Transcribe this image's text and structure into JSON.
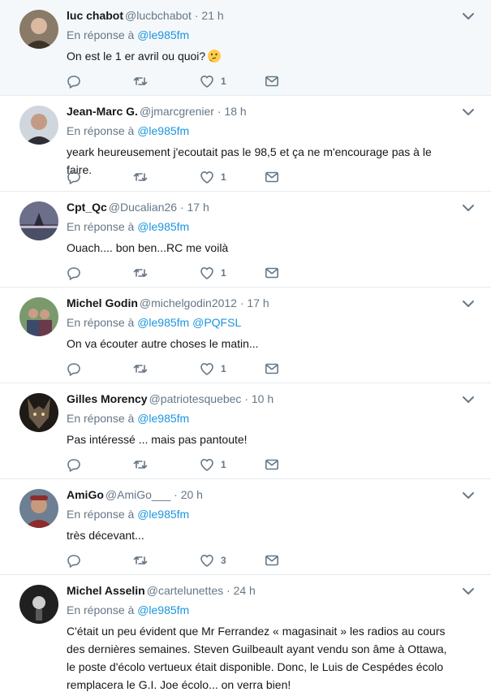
{
  "colors": {
    "accent": "#1b95e0",
    "muted": "#657786",
    "text": "#14171a",
    "highlight_bg": "#f5f8fa"
  },
  "reply_prefix": "En réponse à",
  "tweets": [
    {
      "name": "luc chabot",
      "handle": "@lucbchabot",
      "time": "21 h",
      "mentions": [
        "@le985fm"
      ],
      "text": "On est le 1 er avril ou quoi?",
      "emoji": "thinking-face",
      "likes": "1",
      "avatar": "avatar-1"
    },
    {
      "name": "Jean-Marc G.",
      "handle": "@jmarcgrenier",
      "time": "18 h",
      "mentions": [
        "@le985fm"
      ],
      "text": "yeark heureusement j'ecoutait pas le 98,5 et ça ne m'encourage pas à le faire.",
      "likes": "1",
      "avatar": "avatar-2"
    },
    {
      "name": "Cpt_Qc",
      "handle": "@Ducalian26",
      "time": "17 h",
      "mentions": [
        "@le985fm"
      ],
      "text": "Ouach.... bon ben...RC me voilà",
      "likes": "1",
      "avatar": "avatar-3"
    },
    {
      "name": "Michel Godin",
      "handle": "@michelgodin2012",
      "time": "17 h",
      "mentions": [
        "@le985fm",
        "@PQFSL"
      ],
      "text": "On va écouter autre choses le matin...",
      "likes": "1",
      "avatar": "avatar-4"
    },
    {
      "name": "Gilles Morency",
      "handle": "@patriotesquebec",
      "time": "10 h",
      "mentions": [
        "@le985fm"
      ],
      "text": "Pas intéressé ... mais pas pantoute!",
      "likes": "1",
      "avatar": "avatar-5"
    },
    {
      "name": "AmiGo",
      "handle": "@AmiGo___",
      "time": "20 h",
      "mentions": [
        "@le985fm"
      ],
      "text": "très décevant...",
      "likes": "3",
      "avatar": "avatar-6"
    },
    {
      "name": "Michel Asselin",
      "handle": "@cartelunettes",
      "time": "24 h",
      "mentions": [
        "@le985fm"
      ],
      "text": "C'était un peu évident que Mr Ferrandez « magasinait » les radios au cours des dernières semaines. Steven Guilbeault ayant vendu son âme à Ottawa, le poste d'écolo vertueux était disponible. Donc, le Luis de Cespédes écolo remplacera le G.I. Joe écolo... on verra bien!",
      "likes": "",
      "avatar": "avatar-7"
    }
  ]
}
